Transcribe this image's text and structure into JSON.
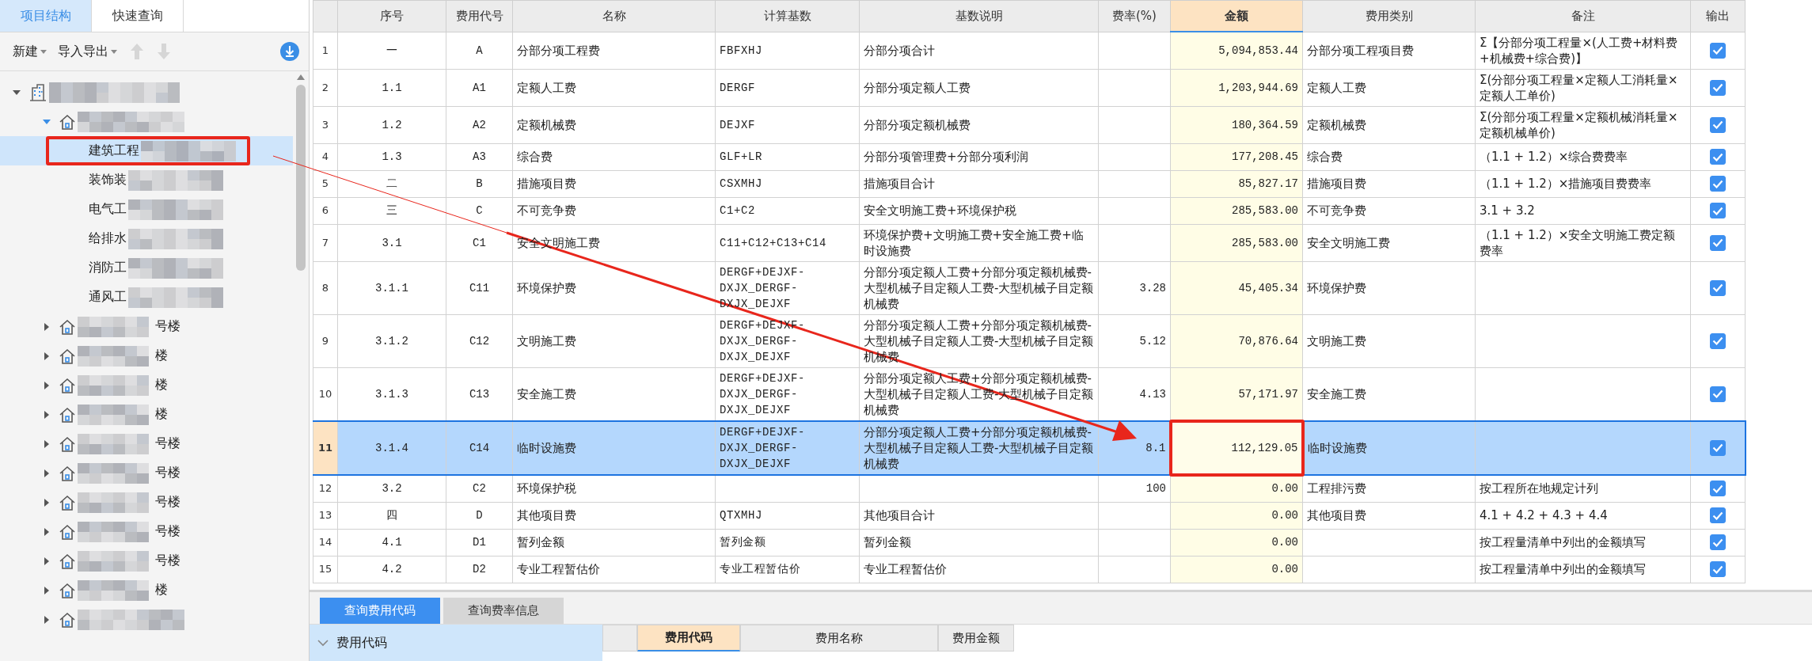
{
  "left_panel": {
    "tabs": [
      {
        "label": "项目结构",
        "selected": true
      },
      {
        "label": "快速查询",
        "selected": false
      }
    ],
    "toolbar": {
      "menus": [
        {
          "label": "新建"
        },
        {
          "label": "导入导出"
        }
      ],
      "reorder_buttons": [
        {
          "kind": "up",
          "disabled": true
        },
        {
          "kind": "down",
          "disabled": true
        }
      ]
    },
    "tree": [
      {
        "kind": "project",
        "expanded": true,
        "selected": false,
        "children": [
          {
            "kind": "building",
            "expanded": true,
            "selected": false,
            "children": [
              {
                "kind": "unit",
                "label": "建筑工程",
                "selected": true
              },
              {
                "kind": "unit",
                "label": "装饰装",
                "selected": false
              },
              {
                "kind": "unit",
                "label": "电气工",
                "selected": false
              },
              {
                "kind": "unit",
                "label": "给排水",
                "selected": false
              },
              {
                "kind": "unit",
                "label": "消防工",
                "selected": false
              },
              {
                "kind": "unit",
                "label": "通风工",
                "selected": false
              }
            ]
          },
          {
            "kind": "building",
            "label": "号楼",
            "expanded": false,
            "selected": false
          },
          {
            "kind": "building",
            "label": "楼",
            "expanded": false,
            "selected": false
          },
          {
            "kind": "building",
            "label": "楼",
            "expanded": false,
            "selected": false
          },
          {
            "kind": "building",
            "label": "楼",
            "expanded": false,
            "selected": false
          },
          {
            "kind": "building",
            "label": "号楼",
            "expanded": false,
            "selected": false
          },
          {
            "kind": "building",
            "label": "号楼",
            "expanded": false,
            "selected": false
          },
          {
            "kind": "building",
            "label": "号楼",
            "expanded": false,
            "selected": false
          },
          {
            "kind": "building",
            "label": "号楼",
            "expanded": false,
            "selected": false
          },
          {
            "kind": "building",
            "label": "号楼",
            "expanded": false,
            "selected": false
          },
          {
            "kind": "building",
            "label": "楼",
            "expanded": false,
            "selected": false
          },
          {
            "kind": "building",
            "expanded": false,
            "selected": false
          }
        ]
      }
    ]
  },
  "table": {
    "columns": [
      {
        "label": "序号",
        "selected": false
      },
      {
        "label": "费用代号",
        "selected": false
      },
      {
        "label": "名称",
        "selected": false
      },
      {
        "label": "计算基数",
        "selected": false
      },
      {
        "label": "基数说明",
        "selected": false
      },
      {
        "label": "费率(%)",
        "selected": false
      },
      {
        "label": "金额",
        "selected": true
      },
      {
        "label": "费用类别",
        "selected": false
      },
      {
        "label": "备注",
        "selected": false
      },
      {
        "label": "输出",
        "selected": false
      }
    ],
    "rows": [
      {
        "row_number": "1",
        "seq": "一",
        "code": "A",
        "name": "分部分项工程费",
        "base": "FBFXHJ",
        "base_note": "分部分项合计",
        "amount": "5,094,853.44",
        "category": "分部分项工程项目费",
        "note": "Σ【分部分项工程量×(人工费+材料费+机械费+综合费)】",
        "output": true,
        "selected": false
      },
      {
        "row_number": "2",
        "seq": "1.1",
        "code": "A1",
        "name": "定额人工费",
        "base": "DERGF",
        "base_note": "分部分项定额人工费",
        "amount": "1,203,944.69",
        "category": "定额人工费",
        "note": "Σ(分部分项工程量×定额人工消耗量×定额人工单价)",
        "output": true,
        "selected": false
      },
      {
        "row_number": "3",
        "seq": "1.2",
        "code": "A2",
        "name": "定额机械费",
        "base": "DEJXF",
        "base_note": "分部分项定额机械费",
        "amount": "180,364.59",
        "category": "定额机械费",
        "note": "Σ(分部分项工程量×定额机械消耗量×定额机械单价)",
        "output": true,
        "selected": false
      },
      {
        "row_number": "4",
        "seq": "1.3",
        "code": "A3",
        "name": "综合费",
        "base": "GLF+LR",
        "base_note": "分部分项管理费+分部分项利润",
        "amount": "177,208.45",
        "category": "综合费",
        "note": "（1.1 + 1.2）×综合费费率",
        "output": true,
        "selected": false
      },
      {
        "row_number": "5",
        "seq": "二",
        "code": "B",
        "name": "措施项目费",
        "base": "CSXMHJ",
        "base_note": "措施项目合计",
        "amount": "85,827.17",
        "category": "措施项目费",
        "note": "（1.1 + 1.2）×措施项目费费率",
        "output": true,
        "selected": false
      },
      {
        "row_number": "6",
        "seq": "三",
        "code": "C",
        "name": "不可竞争费",
        "base": "C1+C2",
        "base_note": "安全文明施工费+环境保护税",
        "amount": "285,583.00",
        "category": "不可竞争费",
        "note": "3.1 + 3.2",
        "output": true,
        "selected": false
      },
      {
        "row_number": "7",
        "seq": "3.1",
        "code": "C1",
        "name": "安全文明施工费",
        "base": "C11+C12+C13+C14",
        "base_note": "环境保护费+文明施工费+安全施工费+临时设施费",
        "amount": "285,583.00",
        "category": "安全文明施工费",
        "note": "（1.1 + 1.2）×安全文明施工费定额费率",
        "output": true,
        "selected": false
      },
      {
        "row_number": "8",
        "seq": "3.1.1",
        "code": "C11",
        "name": "环境保护费",
        "base": "DERGF+DEJXF-DXJX_DERGF-DXJX_DEJXF",
        "base_note": "分部分项定额人工费+分部分项定额机械费-大型机械子目定额人工费-大型机械子目定额机械费",
        "rate": "3.28",
        "amount": "45,405.34",
        "category": "环境保护费",
        "output": true,
        "selected": false
      },
      {
        "row_number": "9",
        "seq": "3.1.2",
        "code": "C12",
        "name": "文明施工费",
        "base": "DERGF+DEJXF-DXJX_DERGF-DXJX_DEJXF",
        "base_note": "分部分项定额人工费+分部分项定额机械费-大型机械子目定额人工费-大型机械子目定额机械费",
        "rate": "5.12",
        "amount": "70,876.64",
        "category": "文明施工费",
        "output": true,
        "selected": false
      },
      {
        "row_number": "10",
        "seq": "3.1.3",
        "code": "C13",
        "name": "安全施工费",
        "base": "DERGF+DEJXF-DXJX_DERGF-DXJX_DEJXF",
        "base_note": "分部分项定额人工费+分部分项定额机械费-大型机械子目定额人工费-大型机械子目定额机械费",
        "rate": "4.13",
        "amount": "57,171.97",
        "category": "安全施工费",
        "output": true,
        "selected": false
      },
      {
        "row_number": "11",
        "seq": "3.1.4",
        "code": "C14",
        "name": "临时设施费",
        "base": "DERGF+DEJXF-DXJX_DERGF-DXJX_DEJXF",
        "base_note": "分部分项定额人工费+分部分项定额机械费-大型机械子目定额人工费-大型机械子目定额机械费",
        "rate": "8.1",
        "amount": "112,129.05",
        "category": "临时设施费",
        "output": true,
        "selected": true
      },
      {
        "row_number": "12",
        "seq": "3.2",
        "code": "C2",
        "name": "环境保护税",
        "rate": "100",
        "amount": "0.00",
        "category": "工程排污费",
        "note": "按工程所在地规定计列",
        "output": true,
        "selected": false
      },
      {
        "row_number": "13",
        "seq": "四",
        "code": "D",
        "name": "其他项目费",
        "base": "QTXMHJ",
        "base_note": "其他项目合计",
        "amount": "0.00",
        "category": "其他项目费",
        "note": "4.1 + 4.2 + 4.3 + 4.4",
        "output": true,
        "selected": false
      },
      {
        "row_number": "14",
        "seq": "4.1",
        "code": "D1",
        "name": "暂列金额",
        "base": "暂列金额",
        "base_note": "暂列金额",
        "amount": "0.00",
        "note": "按工程量清单中列出的金额填写",
        "output": true,
        "selected": false
      },
      {
        "row_number": "15",
        "seq": "4.2",
        "code": "D2",
        "name": "专业工程暂估价",
        "base": "专业工程暂估价",
        "base_note": "专业工程暂估价",
        "amount": "0.00",
        "note": "按工程量清单中列出的金额填写",
        "output": true,
        "selected": false
      }
    ]
  },
  "bottom_panel": {
    "tabs": [
      {
        "label": "查询费用代码",
        "selected": true
      },
      {
        "label": "查询费率信息",
        "selected": false
      }
    ],
    "code_group": {
      "label": "费用代码",
      "expanded": true
    },
    "columns": [
      {
        "label": "费用代码",
        "selected": true
      },
      {
        "label": "费用名称",
        "selected": false
      },
      {
        "label": "费用金额",
        "selected": false
      }
    ]
  }
}
